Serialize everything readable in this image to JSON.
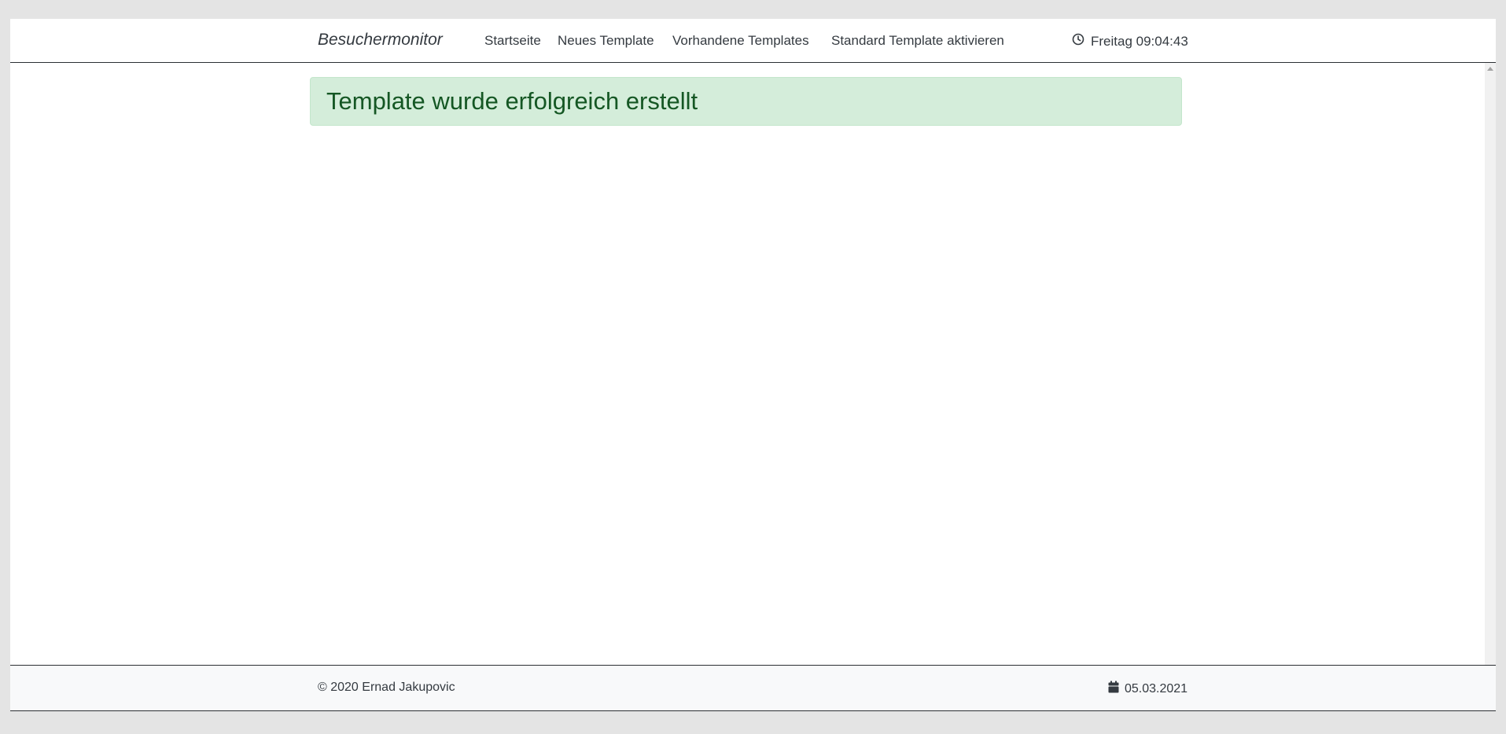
{
  "navbar": {
    "brand": "Besuchermonitor",
    "links": [
      {
        "label": "Startseite"
      },
      {
        "label": "Neues Template"
      },
      {
        "label": "Vorhandene Templates"
      },
      {
        "label": "Standard Template aktivieren"
      }
    ],
    "clock": {
      "icon": "clock-icon",
      "text": "Freitag 09:04:43"
    }
  },
  "alert": {
    "message": "Template wurde erfolgreich erstellt",
    "type": "success",
    "background": "#d4edda",
    "text_color": "#155724"
  },
  "footer": {
    "copyright": "© 2020 Ernad Jakupovic",
    "date": {
      "icon": "calendar-icon",
      "text": "05.03.2021"
    }
  }
}
